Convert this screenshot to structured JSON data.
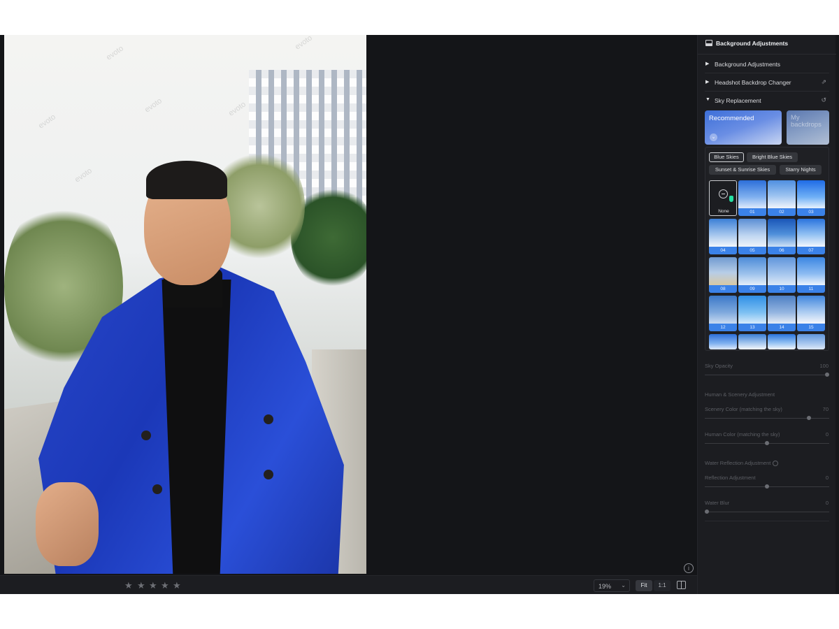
{
  "panel": {
    "title": "Background Adjustments",
    "sections": [
      {
        "label": "Background Adjustments",
        "expanded": false
      },
      {
        "label": "Headshot Backdrop Changer",
        "expanded": false,
        "icon": "external-link-icon"
      },
      {
        "label": "Sky Replacement",
        "expanded": true,
        "icon": "reset-icon"
      }
    ],
    "cards": {
      "recommended": "Recommended",
      "my_backdrops": "My backdrops"
    },
    "categories": [
      "Blue Skies",
      "Bright Blue Skies",
      "Sunset & Sunrise Skies",
      "Starry Nights"
    ],
    "active_category": "Blue Skies",
    "none_label": "None",
    "sky_thumbs": [
      "01",
      "02",
      "03",
      "04",
      "05",
      "06",
      "07",
      "08",
      "09",
      "10",
      "11",
      "12",
      "13",
      "14",
      "15"
    ],
    "sliders": [
      {
        "label": "Sky Opacity",
        "value": "100",
        "level": 1.0
      },
      {
        "label": "Scenery Color (matching the sky)",
        "value": "70",
        "level": 0.85
      },
      {
        "label": "Human Color (matching the sky)",
        "value": "0",
        "level": 0.5
      },
      {
        "label": "Reflection Adjustment",
        "value": "0",
        "level": 0.5
      },
      {
        "label": "Water Blur",
        "value": "0",
        "level": 0.0
      }
    ],
    "groups": {
      "human": "Human & Scenery Adjustment",
      "water": "Water Reflection Adjustment"
    }
  },
  "toolbar": {
    "rating_stars": 5,
    "zoom": "19%",
    "fit": "Fit",
    "one_to_one": "1:1"
  },
  "watermark": "evoto",
  "accent_color": "#3b82e8"
}
